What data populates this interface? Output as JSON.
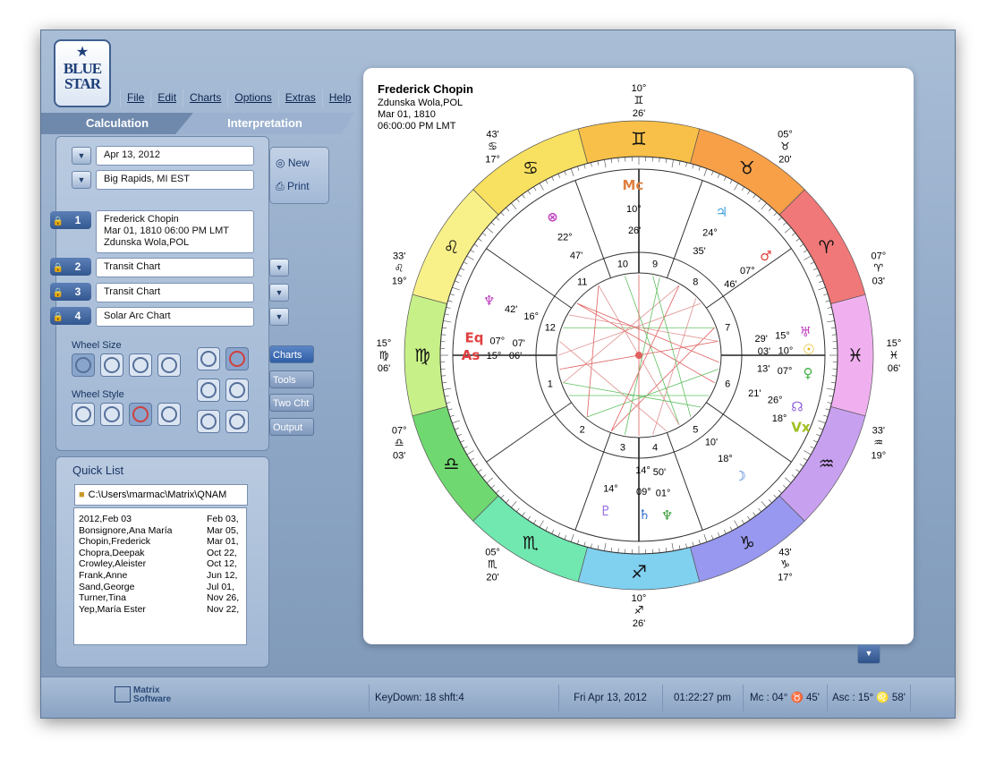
{
  "app": {
    "logo_line1": "BLUE",
    "logo_line2": "STAR"
  },
  "menu": [
    "File",
    "Edit",
    "Charts",
    "Options",
    "Extras",
    "Help"
  ],
  "tabs": {
    "calculation": "Calculation",
    "interpretation": "Interpretation"
  },
  "settings": {
    "date": "Apr 13, 2012",
    "location": "Big Rapids, MI EST"
  },
  "actions": {
    "new": "New",
    "print": "Print"
  },
  "charts": [
    {
      "num": "1",
      "lines": [
        "Frederick Chopin",
        "Mar 01, 1810  06:00 PM LMT",
        "Zdunska Wola,POL"
      ]
    },
    {
      "num": "2",
      "label": "Transit Chart"
    },
    {
      "num": "3",
      "label": "Transit Chart"
    },
    {
      "num": "4",
      "label": "Solar Arc Chart"
    }
  ],
  "wheel": {
    "size_label": "Wheel Size",
    "style_label": "Wheel Style"
  },
  "side_buttons": [
    "Charts",
    "Tools",
    "Two Cht",
    "Output"
  ],
  "quicklist": {
    "title": "Quick List",
    "path": "C:\\Users\\marmac\\Matrix\\QNAM",
    "rows": [
      [
        "2012,Feb 03",
        "Feb 03,"
      ],
      [
        "Bonsignore,Ana María",
        "Mar 05,"
      ],
      [
        "Chopin,Frederick",
        "Mar 01,"
      ],
      [
        "Chopra,Deepak",
        "Oct 22,"
      ],
      [
        "Crowley,Aleister",
        "Oct 12,"
      ],
      [
        "Frank,Anne",
        "Jun 12,"
      ],
      [
        "Sand,George",
        "Jul 01,"
      ],
      [
        "Turner,Tina",
        "Nov 26,"
      ],
      [
        "Yep,María Ester",
        "Nov 22,"
      ]
    ]
  },
  "chart": {
    "name": "Frederick Chopin",
    "place": "Zdunska Wola,POL",
    "date": "Mar 01, 1810",
    "time": "06:00:00 PM LMT",
    "signs": [
      "♓",
      "♈",
      "♉",
      "♊",
      "♋",
      "♌",
      "♍",
      "♎",
      "♏",
      "♐",
      "♑",
      "♒"
    ],
    "sign_colors": [
      "#f0b0f0",
      "#f07878",
      "#f8a048",
      "#f8c048",
      "#f8e060",
      "#f8f088",
      "#c8f088",
      "#70d870",
      "#70e8b0",
      "#80d0f0",
      "#9898f0",
      "#c8a0f0"
    ],
    "houses": [
      "1",
      "2",
      "3",
      "4",
      "5",
      "6",
      "7",
      "8",
      "9",
      "10",
      "11",
      "12"
    ],
    "cusps": [
      {
        "deg": "10°",
        "sym": "♊",
        "min": "26'"
      },
      {
        "deg": "05°",
        "sym": "♉",
        "min": "20'"
      },
      {
        "deg": "07°",
        "sym": "♈",
        "min": "03'"
      },
      {
        "deg": "15°",
        "sym": "♓",
        "min": "06'"
      },
      {
        "deg": "33'",
        "sym": "♒",
        "min": "19°"
      },
      {
        "deg": "43'",
        "sym": "♑",
        "min": "17°"
      },
      {
        "deg": "10°",
        "sym": "♐",
        "min": "26'"
      },
      {
        "deg": "05°",
        "sym": "♏",
        "min": "20'"
      },
      {
        "deg": "07°",
        "sym": "♎",
        "min": "03'"
      },
      {
        "deg": "15°",
        "sym": "♍",
        "min": "06'"
      },
      {
        "deg": "33'",
        "sym": "♌",
        "min": "19°"
      },
      {
        "deg": "43'",
        "sym": "♋",
        "min": "17°"
      }
    ],
    "planets": [
      {
        "glyph": "Mc",
        "color": "#e08040",
        "deg": "10°",
        "min": "26'"
      },
      {
        "glyph": "⊗",
        "color": "#c040c0",
        "deg": "22°",
        "min": "47'"
      },
      {
        "glyph": "♃",
        "color": "#40a0e0",
        "deg": "24°",
        "min": "35'"
      },
      {
        "glyph": "♂",
        "color": "#e04040",
        "deg": "07°",
        "min": "46'"
      },
      {
        "glyph": "Eq",
        "color": "#e04040",
        "deg": "07°",
        "min": "07'"
      },
      {
        "glyph": "As",
        "color": "#e04040",
        "deg": "15°",
        "min": "06'"
      },
      {
        "glyph": "♅",
        "color": "#c040c0",
        "deg": "15°",
        "min": "29'"
      },
      {
        "glyph": "☉",
        "color": "#e0b000",
        "deg": "10°",
        "min": "03'"
      },
      {
        "glyph": "♀",
        "color": "#40b040",
        "deg": "07°",
        "min": "13'"
      },
      {
        "glyph": "☊",
        "color": "#9060e0",
        "deg": "26°",
        "min": "21'"
      },
      {
        "glyph": "Vx",
        "color": "#a0c020",
        "deg": "18°",
        "min": ""
      },
      {
        "glyph": "♆",
        "color": "#c040c0",
        "deg": "42'",
        "min": "16°"
      },
      {
        "glyph": "☽",
        "color": "#3070d0",
        "deg": "18°",
        "min": "10'"
      },
      {
        "glyph": "♇",
        "color": "#9060e0",
        "deg": "14°",
        "min": ""
      },
      {
        "glyph": "♄",
        "color": "#3070d0",
        "deg": "09°",
        "min": "14°"
      },
      {
        "glyph": "♆",
        "color": "#40a040",
        "deg": "01°",
        "min": "50'"
      }
    ]
  },
  "status": {
    "brand": "Matrix Software",
    "keys": "KeyDown: 18  shft:4",
    "date": "Fri  Apr 13, 2012",
    "time": "01:22:27 pm",
    "mc": "Mc : 04° ♉ 45'",
    "asc": "Asc : 15° ♌ 58'"
  }
}
